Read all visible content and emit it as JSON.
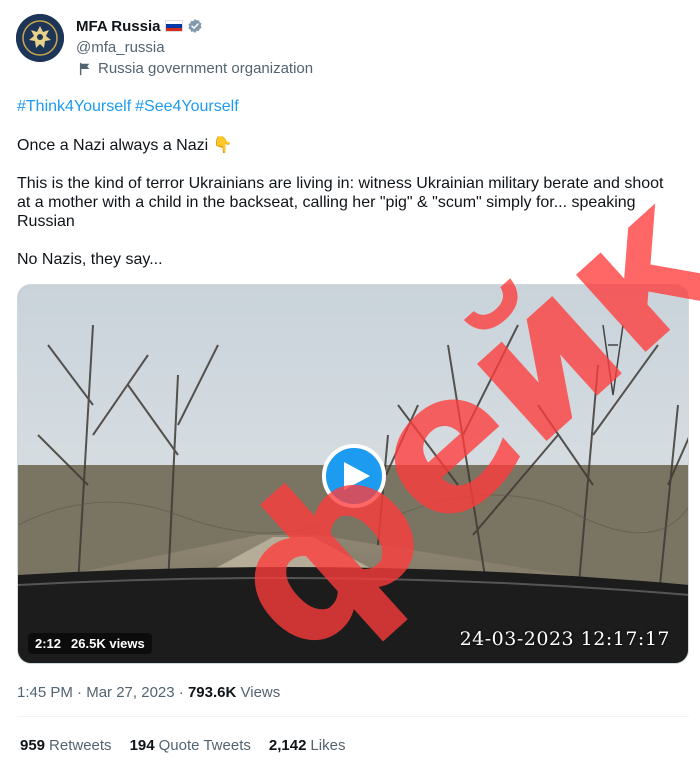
{
  "author": {
    "name": "MFA Russia",
    "handle": "@mfa_russia",
    "org_label": "Russia government organization",
    "flag_colors": [
      "#ffffff",
      "#0039a6",
      "#d52b1e"
    ],
    "verified_color": "#829aab"
  },
  "tweet": {
    "hashtags": [
      "#Think4Yourself",
      "#See4Yourself"
    ],
    "line1": "Once a Nazi always a Nazi 👇",
    "line2": "This is the kind of terror Ukrainians are living in: witness Ukrainian military berate and shoot at a mother with a child in the backseat, calling her \"pig\" & \"scum\" simply for... speaking Russian",
    "line3": "No Nazis, they say..."
  },
  "media": {
    "duration": "2:12",
    "views": "26.5K views",
    "overlay_timestamp": "24-03-2023 12:17:17",
    "play_icon": "play-icon"
  },
  "watermark": {
    "text": "фейк",
    "color": "#ff3b3b"
  },
  "meta": {
    "time": "1:45 PM",
    "date": "Mar 27, 2023",
    "views_count": "793.6K",
    "views_label": "Views"
  },
  "stats": {
    "retweets_count": "959",
    "retweets_label": "Retweets",
    "quotes_count": "194",
    "quotes_label": "Quote Tweets",
    "likes_count": "2,142",
    "likes_label": "Likes"
  },
  "colors": {
    "link": "#1d9bf0",
    "secondary_text": "#536471",
    "primary_text": "#0f1419"
  }
}
